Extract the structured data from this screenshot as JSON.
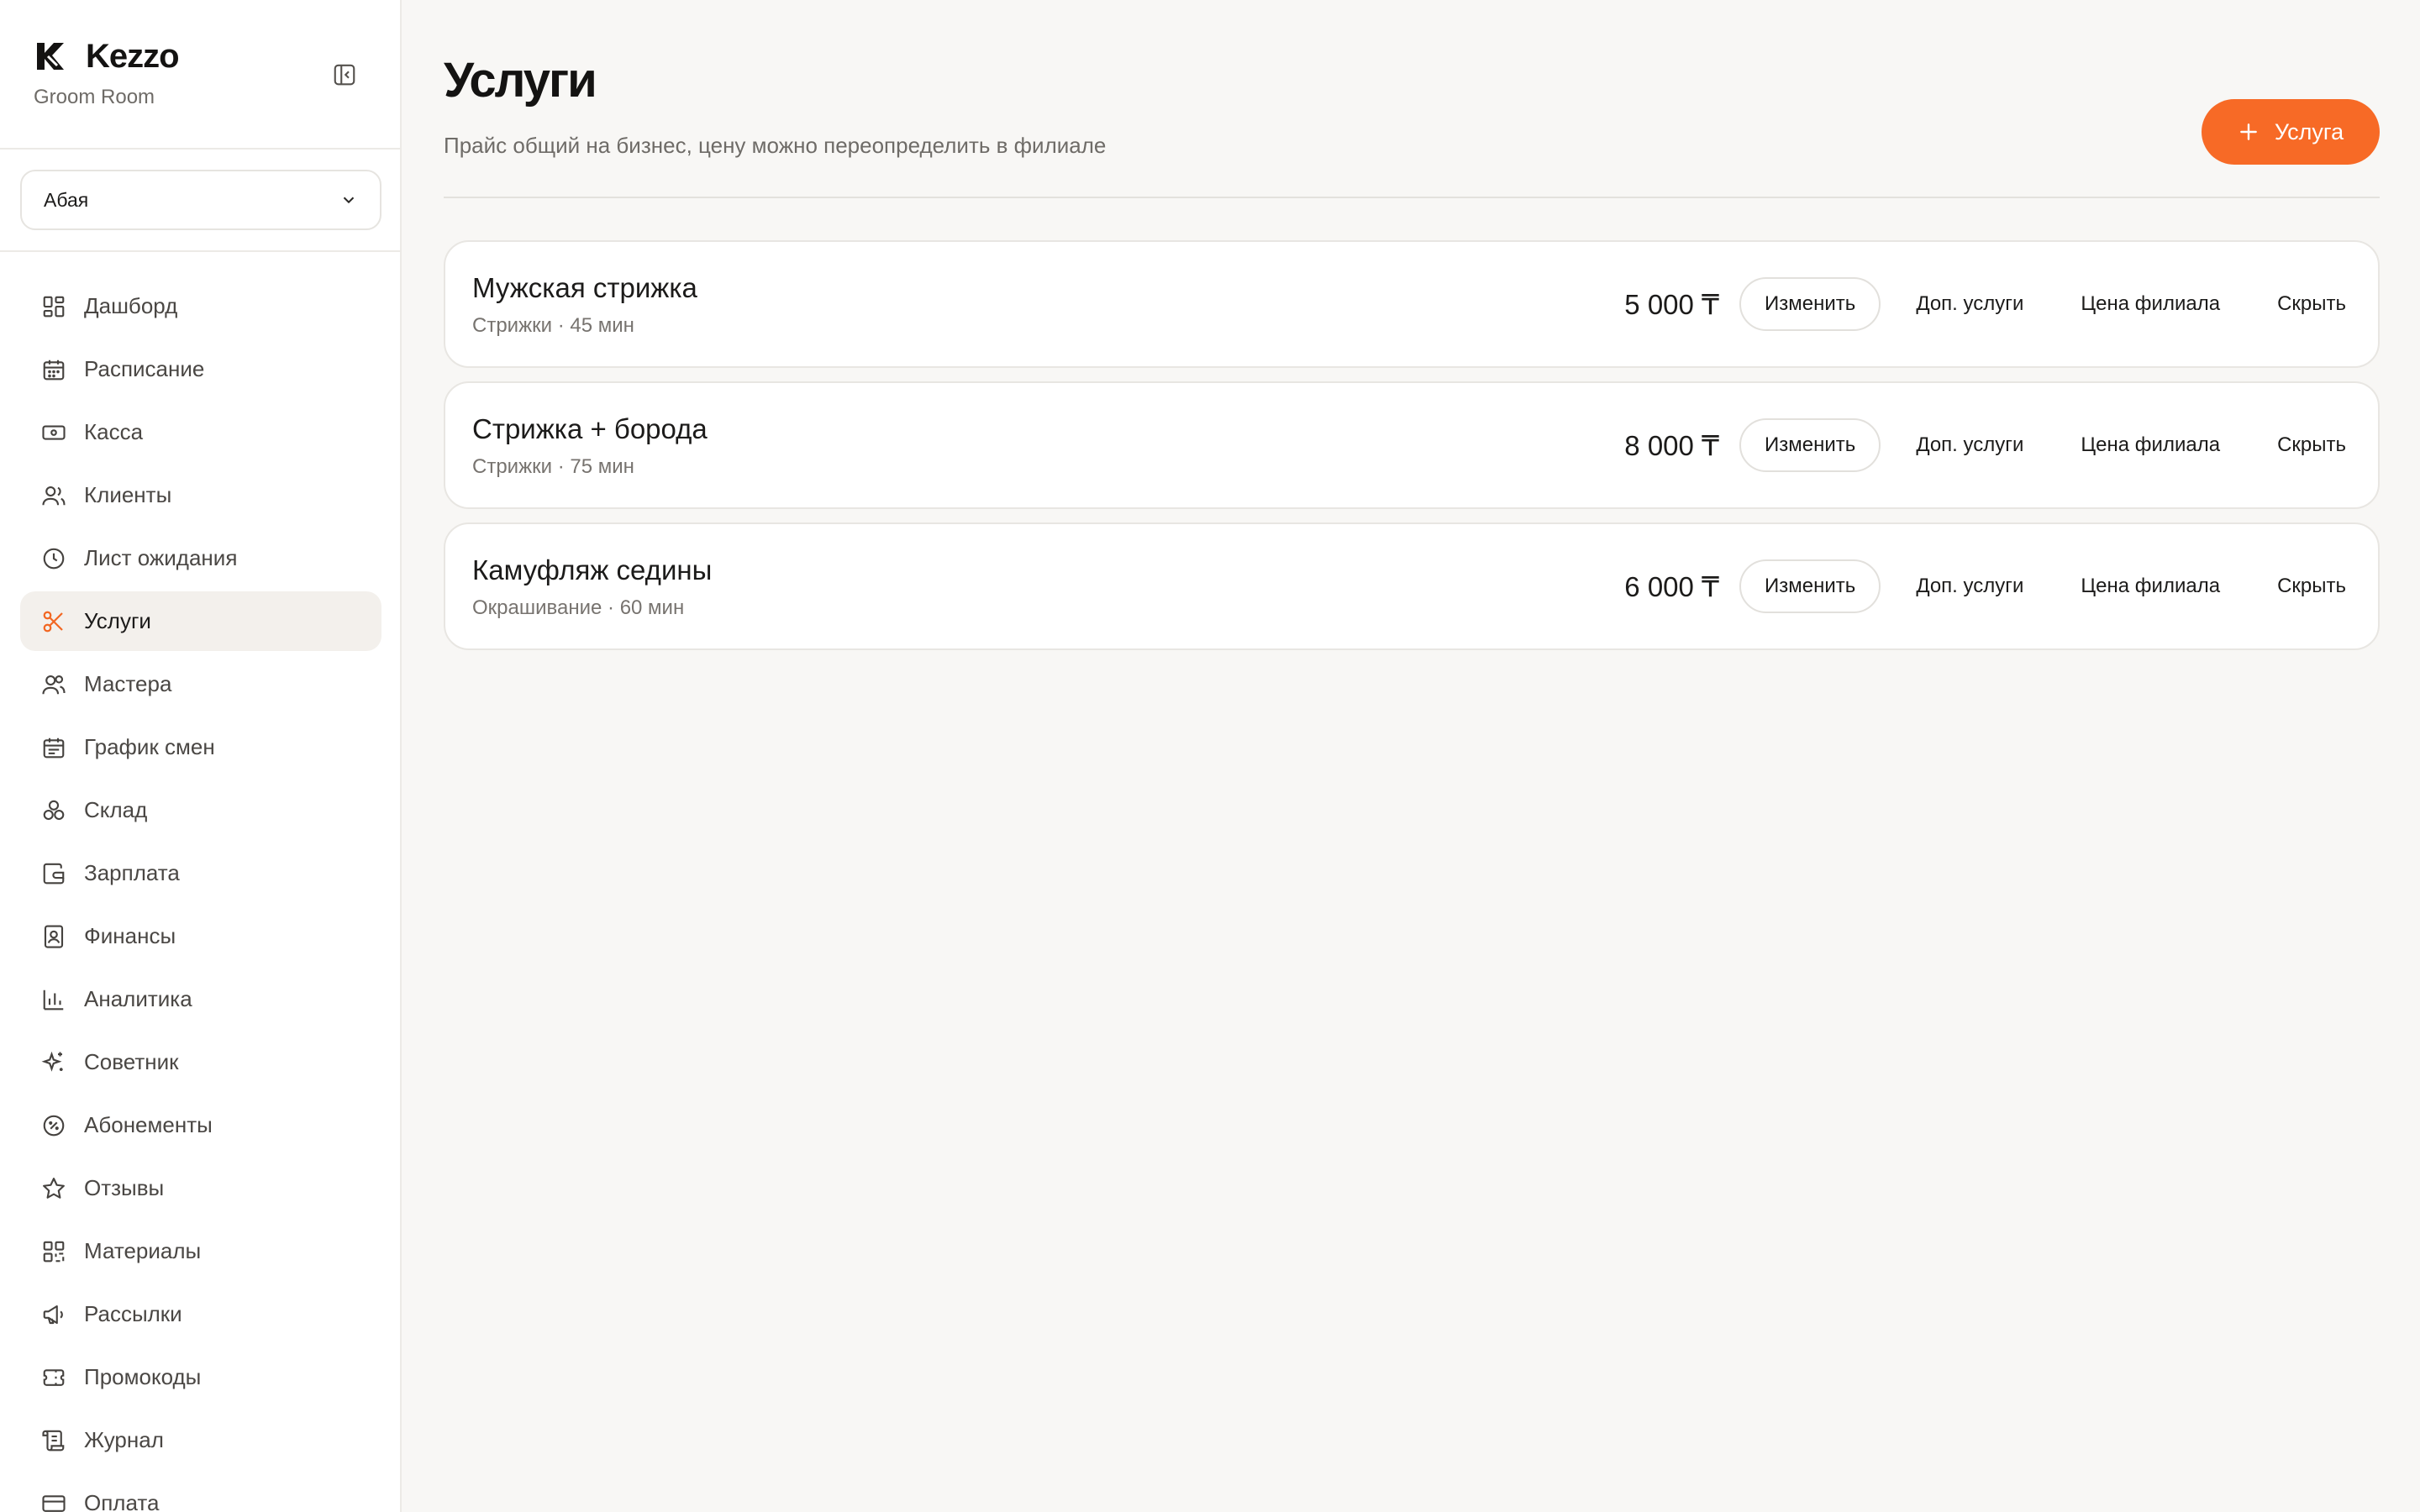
{
  "brand": {
    "name": "Kezzo",
    "subtitle": "Groom Room"
  },
  "branch_select": {
    "value": "Абая"
  },
  "nav": {
    "items": [
      {
        "label": "Дашборд",
        "icon": "dashboard-icon"
      },
      {
        "label": "Расписание",
        "icon": "calendar-icon"
      },
      {
        "label": "Касса",
        "icon": "cash-icon"
      },
      {
        "label": "Клиенты",
        "icon": "users-icon"
      },
      {
        "label": "Лист ожидания",
        "icon": "clock-icon"
      },
      {
        "label": "Услуги",
        "icon": "scissors-icon",
        "active": true
      },
      {
        "label": "Мастера",
        "icon": "masters-icon"
      },
      {
        "label": "График смен",
        "icon": "schedule-icon"
      },
      {
        "label": "Склад",
        "icon": "boxes-icon"
      },
      {
        "label": "Зарплата",
        "icon": "wallet-icon"
      },
      {
        "label": "Финансы",
        "icon": "ledger-icon"
      },
      {
        "label": "Аналитика",
        "icon": "chart-icon"
      },
      {
        "label": "Советник",
        "icon": "sparkles-icon"
      },
      {
        "label": "Абонементы",
        "icon": "badge-percent-icon"
      },
      {
        "label": "Отзывы",
        "icon": "star-icon"
      },
      {
        "label": "Материалы",
        "icon": "qr-icon"
      },
      {
        "label": "Рассылки",
        "icon": "megaphone-icon"
      },
      {
        "label": "Промокоды",
        "icon": "ticket-icon"
      },
      {
        "label": "Журнал",
        "icon": "scroll-icon"
      },
      {
        "label": "Оплата",
        "icon": "card-icon"
      }
    ]
  },
  "header": {
    "title": "Услуги",
    "subtitle": "Прайс общий на бизнес, цену можно переопределить в филиале",
    "add_label": "Услуга"
  },
  "services": [
    {
      "name": "Мужская стрижка",
      "meta": "Стрижки · 45 мин",
      "price": "5 000 ₸"
    },
    {
      "name": "Стрижка + борода",
      "meta": "Стрижки · 75 мин",
      "price": "8 000 ₸"
    },
    {
      "name": "Камуфляж седины",
      "meta": "Окрашивание · 60 мин",
      "price": "6 000 ₸"
    }
  ],
  "service_actions": {
    "edit": "Изменить",
    "extras": "Доп. услуги",
    "branch_price": "Цена филиала",
    "hide": "Скрыть"
  },
  "colors": {
    "accent": "#f76a26",
    "active_bg": "#f3f0ec",
    "background": "#f8f7f5"
  }
}
